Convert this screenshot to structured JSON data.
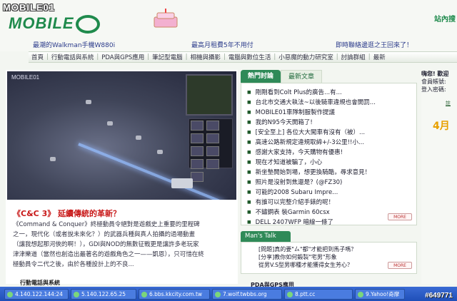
{
  "photo_tag": "MOBILE01",
  "watermark": "#649771",
  "header": {
    "logo_text": "MOBILE",
    "side_title": "站內搜",
    "promos": [
      "最潮的Walkman手機W880i",
      "最高月租費5年不用付",
      "即時聯絡邊逛之王回來了！"
    ]
  },
  "nav": {
    "items": [
      "首頁",
      "行動電話與系統",
      "PDA與GPS應用",
      "筆記型電腦",
      "相機與攝影",
      "電腦與數位生活",
      "小惡魔的動力研究室",
      "討論群組",
      "最新"
    ]
  },
  "feature": {
    "screenshot_logo": "MOBILE01",
    "title": "《C&C 3》 延續傳統的革新？",
    "body_lines": [
      "《Command & Conquer》終極動員令絕對是遊戲史上重要的里程碑",
      "之一，現代化（或者說未來化？）的武器兵種與真人拍攝的過場動畫",
      "（讓我想起那河俠的啊！），GDI與NOD的無數征戰更是讓許多老玩家",
      "津津樂道（當然也創造出最著名的遊戲角色之一——凱恩），只可惜在終",
      "極動員令二代之後，由於各種設計上的不良..."
    ],
    "bottom_box_title": "行動電話與系統"
  },
  "tabs": [
    {
      "label": "熱門討論",
      "active": true
    },
    {
      "label": "最新文章",
      "active": false
    }
  ],
  "hot_topics": [
    "剛剛看到Colt Plus的廣告...有...",
    "台北市交通大執法~以後騎車違規也會開罰...",
    "MOBILE01車隊制服製作提議",
    "我的N95今天開箱了!",
    "[安全至上] 各位大大闖車有沒有（被）...",
    "高速公路新規定違規取締+/-3公里!!小...",
    "感謝大家支持，今天購物有優惠!",
    "現在才知道被騙了，小心",
    "新坐墊開始到場，想更換騎酷，尋求意見！",
    "照片是沒射到焦還是？(@FZ30)",
    "可能的2008 Subaru Impre...",
    "有誰可以完整介紹手錶的呢！",
    "不鏽鋼表 裝Garmin 60csx",
    "DELL 2407WFP 暗線一條了"
  ],
  "more_label": "MORE",
  "mans_talk": {
    "tab_label": "Man's Talk",
    "items": [
      "[問題]真的要\"ㄙ\"都\"才能把到馬子嗎？",
      "[分享]教你如何鍛製\"宅男\"形象",
      "從男V.S型男哪種才能獲得女生芳心？"
    ],
    "more_label": "MORE"
  },
  "mid_bottom_title": "PDA與GPS應用",
  "right_panel": {
    "lines": [
      "嗨您! 歡迎",
      "會員帳號:",
      "登入密碼:"
    ],
    "link": "註",
    "big_text": "4月"
  },
  "taskbar": {
    "tasks": [
      "4.140.122.144:24",
      "5.140.122.65.25",
      "6.bbs.kkcity.com.tw",
      "7.wolf.twbbs.org",
      "8.ptt.cc",
      "9.Yahoo!奇摩"
    ]
  }
}
